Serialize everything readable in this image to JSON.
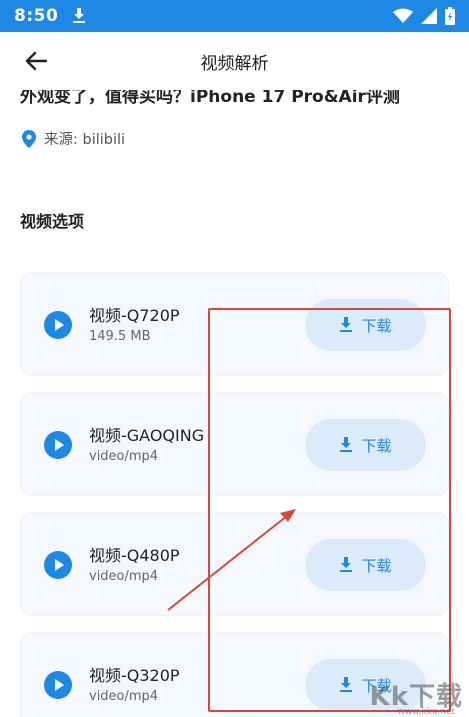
{
  "status_bar": {
    "time": "8:50"
  },
  "app_bar": {
    "title": "视频解析"
  },
  "video": {
    "title": "外观变了，值得买吗？iPhone 17 Pro&Air评测",
    "source": "来源: bilibili"
  },
  "section": {
    "title": "视频选项"
  },
  "options": [
    {
      "name": "视频-Q720P",
      "sub": "149.5 MB",
      "button": "下载"
    },
    {
      "name": "视频-GAOQING",
      "sub": "video/mp4",
      "button": "下载"
    },
    {
      "name": "视频-Q480P",
      "sub": "video/mp4",
      "button": "下载"
    },
    {
      "name": "视频-Q320P",
      "sub": "video/mp4",
      "button": "下载"
    }
  ],
  "watermark": {
    "text": "Kk下载",
    "sub": "www.kkx.net"
  },
  "colors": {
    "accent": "#1e88e5",
    "button_bg": "#dcebfa",
    "card_bg": "#f5f9fd",
    "annotation": "#d8473c"
  }
}
